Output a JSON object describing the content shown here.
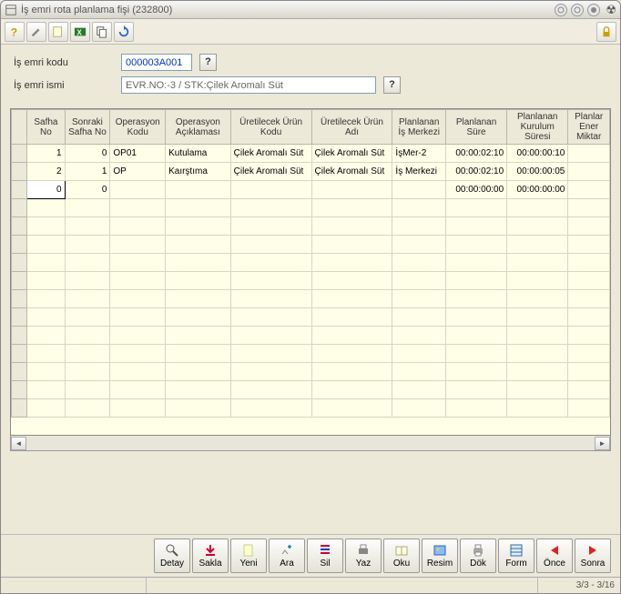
{
  "window": {
    "title": "İş emri rota planlama fişi (232800)"
  },
  "form": {
    "code_label": "İş emri kodu",
    "code_value": "000003A001",
    "name_label": "İş emri ismi",
    "name_value": "EVR.NO:-3 / STK:Çilek Aromalı Süt"
  },
  "grid": {
    "headers": {
      "safha_no": "Safha No",
      "sonraki_safha_no": "Sonraki Safha No",
      "operasyon_kodu": "Operasyon Kodu",
      "operasyon_aciklama": "Operasyon Açıklaması",
      "uretilecek_urun_kodu": "Üretilecek Ürün Kodu",
      "uretilecek_urun_adi": "Üretilecek Ürün Adı",
      "planlanan_is_merkezi": "Planlanan İş Merkezi",
      "planlanan_sure": "Planlanan Süre",
      "planlanan_kurulum_suresi": "Planlanan Kurulum Süresi",
      "planlanan_enerji": "Planlar Ener Miktar"
    },
    "rows": [
      {
        "safha": "1",
        "sonraki": "0",
        "opkod": "OP01",
        "opaci": "Kutulama",
        "urkod": "Çilek Aromalı Süt",
        "uradi": "Çilek Aromalı Süt",
        "ismerk": "İşMer-2",
        "sure": "00:00:02:10",
        "kurulum": "00:00:00:10"
      },
      {
        "safha": "2",
        "sonraki": "1",
        "opkod": "OP",
        "opaci": "Kaırştıma",
        "urkod": "Çilek Aromalı Süt",
        "uradi": "Çilek Aromalı Süt",
        "ismerk": "İş Merkezi",
        "sure": "00:00:02:10",
        "kurulum": "00:00:00:05"
      },
      {
        "safha": "0",
        "sonraki": "0",
        "opkod": "",
        "opaci": "",
        "urkod": "",
        "uradi": "",
        "ismerk": "",
        "sure": "00:00:00:00",
        "kurulum": "00:00:00:00"
      }
    ]
  },
  "buttons": {
    "detay": "Detay",
    "sakla": "Sakla",
    "yeni": "Yeni",
    "ara": "Ara",
    "sil": "Sil",
    "yaz": "Yaz",
    "oku": "Oku",
    "resim": "Resim",
    "dok": "Dök",
    "form": "Form",
    "once": "Önce",
    "sonra": "Sonra"
  },
  "status": {
    "pos": "3/3 - 3/16"
  }
}
